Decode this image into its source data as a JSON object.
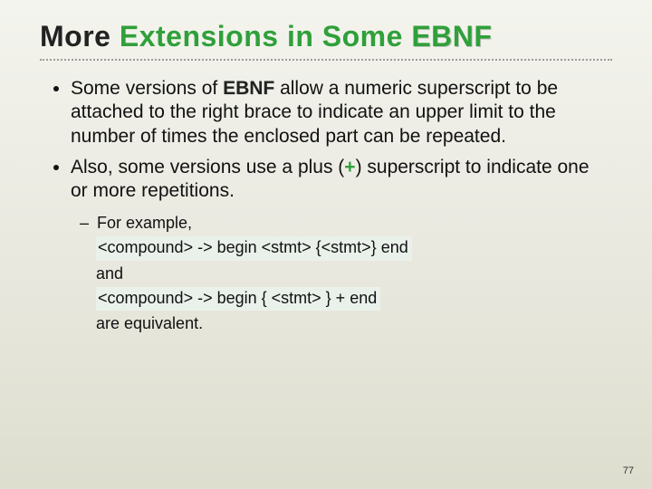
{
  "title": {
    "part1": "More",
    "part2": " Extensions in Some ",
    "ebnf": "EBNF"
  },
  "bullets": [
    {
      "pre": "Some versions of ",
      "ebnf": "EBNF",
      "post": " allow a numeric superscript to be attached to the right brace to indicate an upper limit to the number of times the enclosed part can be repeated."
    },
    {
      "pre": "Also, some versions use a plus (",
      "plus": "+",
      "post": ") superscript to indicate one or more repetitions."
    }
  ],
  "example": {
    "lead": "For example,",
    "code1": "<compound> -> begin <stmt> {<stmt>} end",
    "and": "and",
    "code2": "<compound> -> begin { <stmt> } + end",
    "tail": "are equivalent."
  },
  "page_number": "77"
}
